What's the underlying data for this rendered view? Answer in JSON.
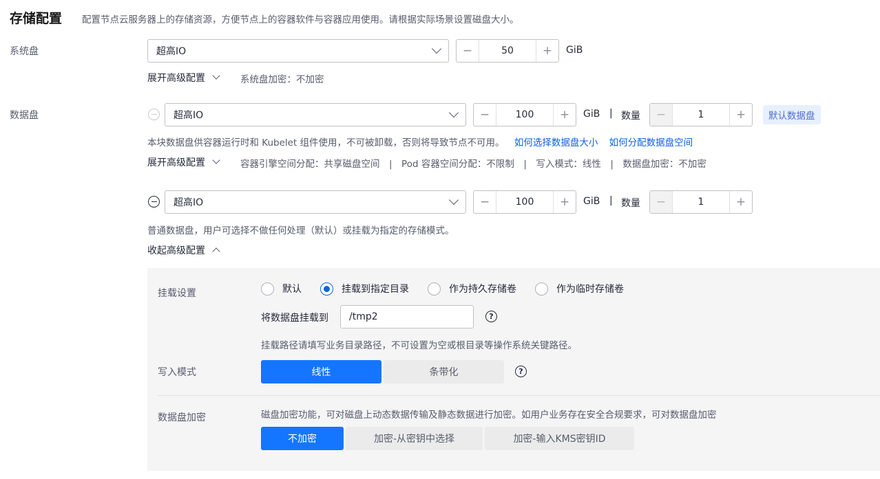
{
  "header": {
    "title": "存储配置",
    "description": "配置节点云服务器上的存储资源，方便节点上的容器软件与容器应用使用。请根据实际场景设置磁盘大小。"
  },
  "system_disk": {
    "label": "系统盘",
    "type": "超高IO",
    "size": "50",
    "unit": "GiB",
    "advanced_toggle": "展开高级配置",
    "encryption": "系统盘加密：不加密"
  },
  "data_disk": {
    "label": "数据盘",
    "disks": [
      {
        "type": "超高IO",
        "size": "100",
        "unit": "GiB",
        "sep": "|",
        "quantity_label": "数量",
        "quantity": "1",
        "tag": "默认数据盘",
        "hint": "本块数据盘供容器运行时和 Kubelet 组件使用，不可被卸载，否则将导致节点不可用。",
        "link1": "如何选择数据盘大小",
        "link2": "如何分配数据盘空间",
        "advanced_toggle": "展开高级配置",
        "meta": "容器引擎空间分配：共享磁盘空间　|　Pod 容器空间分配：不限制　|　写入模式：线性　|　数据盘加密：不加密"
      },
      {
        "type": "超高IO",
        "size": "100",
        "unit": "GiB",
        "sep": "|",
        "quantity_label": "数量",
        "quantity": "1",
        "hint": "普通数据盘，用户可选择不做任何处理（默认）或挂载为指定的存储模式。",
        "advanced_toggle": "收起高级配置"
      }
    ]
  },
  "advanced": {
    "mount_label": "挂载设置",
    "mount_options": [
      "默认",
      "挂载到指定目录",
      "作为持久存储卷",
      "作为临时存储卷"
    ],
    "mount_selected": "挂载到指定目录",
    "mount_path_label": "将数据盘挂载到",
    "mount_path_value": "/tmp2",
    "mount_path_hint": "挂载路径请填写业务目录路径，不可设置为空或根目录等操作系统关键路径。",
    "write_label": "写入模式",
    "write_options": [
      "线性",
      "条带化"
    ],
    "write_selected": "线性",
    "encrypt_label": "数据盘加密",
    "encrypt_desc": "磁盘加密功能，可对磁盘上动态数据传输及静态数据进行加密。如用户业务存在安全合规要求，可对数据盘加密",
    "encrypt_options": [
      "不加密",
      "加密-从密钥中选择",
      "加密-输入KMS密钥ID"
    ],
    "encrypt_selected": "不加密"
  },
  "colors": {
    "primary": "#1476ff",
    "link": "#0d61e6",
    "tag_bg": "#e6f0fe",
    "panel_bg": "#f5f5f6"
  },
  "icons": {
    "minus": "−",
    "plus": "+",
    "help": "?"
  }
}
